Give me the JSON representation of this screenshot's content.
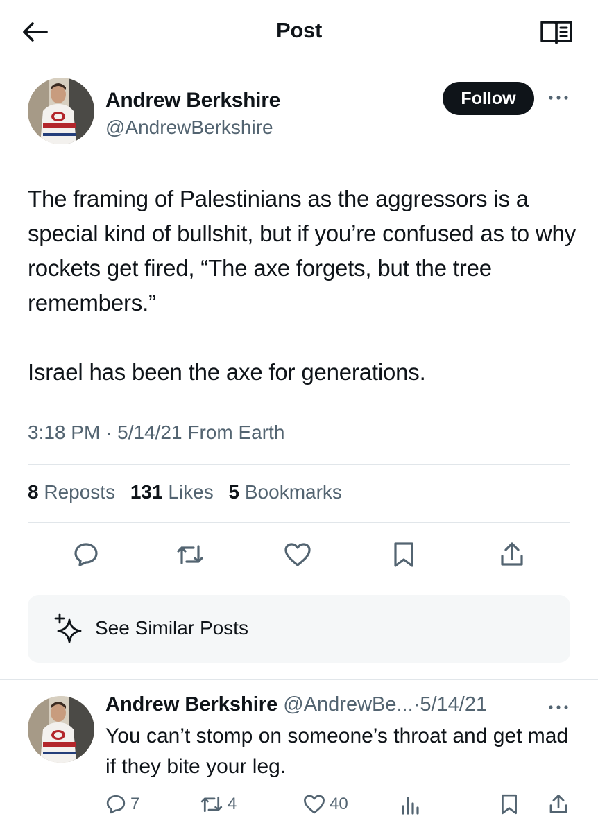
{
  "header": {
    "title": "Post",
    "back_icon": "arrow-left-icon",
    "reader_icon": "reader-mode-icon"
  },
  "post": {
    "author_name": "Andrew Berkshire",
    "author_handle": "@AndrewBerkshire",
    "follow_label": "Follow",
    "body_paragraphs": [
      "The framing of Palestinians as the aggressors is a special kind of bullshit, but if you’re confused as to why rockets get fired, “The axe forgets, but the tree remembers.”",
      "Israel has been the axe for generations."
    ],
    "meta": "3:18 PM · 5/14/21 From Earth",
    "stats": {
      "reposts_count": "8",
      "reposts_label": "Reposts",
      "likes_count": "131",
      "likes_label": "Likes",
      "bookmarks_count": "5",
      "bookmarks_label": "Bookmarks"
    },
    "actions": [
      "reply-icon",
      "repost-icon",
      "like-icon",
      "bookmark-icon",
      "share-icon"
    ]
  },
  "similar": {
    "label": "See Similar Posts",
    "icon": "sparkle-icon"
  },
  "reply": {
    "author_name": "Andrew Berkshire",
    "author_handle": "@AndrewBe...",
    "separator": "·",
    "date": "5/14/21",
    "text": "You can’t stomp on someone’s throat and get mad if they bite your leg.",
    "replies_count": "7",
    "reposts_count": "4",
    "likes_count": "40"
  },
  "colors": {
    "text_primary": "#0f1419",
    "text_secondary": "#536471",
    "divider": "#e1e6ea",
    "follow_bg": "#0f1419",
    "card_bg": "#f5f7f8"
  }
}
